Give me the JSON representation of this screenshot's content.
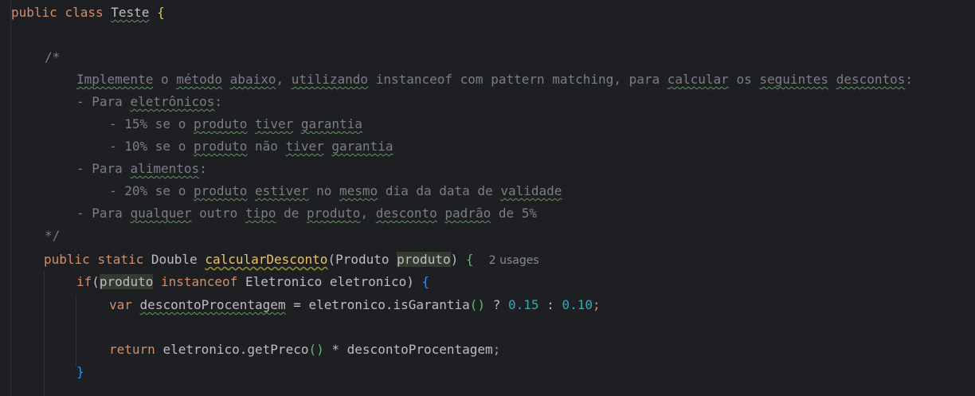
{
  "code": {
    "l1": {
      "public": "public",
      "class": "class",
      "classname": "Teste",
      "brace": "{"
    },
    "l3": {
      "open": "/*"
    },
    "l4": {
      "w1": "Implemente",
      "s1": " o ",
      "w2": "método",
      "s2": " ",
      "w3": "abaixo",
      "s3": ", ",
      "w4": "utilizando",
      "s4": " instanceof com pattern matching, para ",
      "w5": "calcular",
      "s5": " os ",
      "w6": "seguintes",
      "s6": " ",
      "w7": "descontos",
      "s7": ":"
    },
    "l5": {
      "pre": "- Para ",
      "w1": "eletrônicos",
      "post": ":"
    },
    "l6": {
      "pre": "- 15% se o ",
      "w1": "produto",
      "s1": " ",
      "w2": "tiver",
      "s2": " ",
      "w3": "garantia"
    },
    "l7": {
      "pre": "- 10% se o ",
      "w1": "produto",
      "s1": " não ",
      "w2": "tiver",
      "s2": " ",
      "w3": "garantia"
    },
    "l8": {
      "pre": "- Para ",
      "w1": "alimentos",
      "post": ":"
    },
    "l9": {
      "pre": "- 20% se o ",
      "w1": "produto",
      "s1": " ",
      "w2": "estiver",
      "s2": " no ",
      "w3": "mesmo",
      "s3": " dia da data de ",
      "w4": "validade"
    },
    "l10": {
      "pre": "- Para ",
      "w1": "qualquer",
      "s1": " outro ",
      "w2": "tipo",
      "s2": " de ",
      "w3": "produto",
      "s3": ", ",
      "w4": "desconto",
      "s4": " ",
      "w5": "padrão",
      "s5": " de 5%"
    },
    "l11": {
      "close": "*/"
    },
    "l12": {
      "public": "public",
      "static": "static",
      "type": "Double",
      "method": "calcularDesconto",
      "paren_open": "(",
      "ptype": "Produto",
      "pname": "produto",
      "paren_close": ")",
      "brace": "{",
      "usages": "2 usages"
    },
    "l13": {
      "if": "if",
      "paren_open": "(",
      "var": "produto",
      "instanceof": "instanceof",
      "cls": "Eletronico",
      "name": "eletronico",
      "paren_close": ")",
      "brace": "{"
    },
    "l14": {
      "var": "var",
      "name": "descontoProcentagem",
      "eq": "=",
      "call": "eletronico.isGarantia",
      "parens": "()",
      "q": "?",
      "n1": "0.15",
      "colon": ":",
      "n2": "0.10",
      "semi": ";"
    },
    "l16": {
      "return": "return",
      "call": "eletronico.getPreco",
      "parens": "()",
      "op": "*",
      "name": "descontoProcentagem",
      "semi": ";"
    },
    "l17": {
      "brace": "}"
    }
  },
  "colors": {
    "background": "#1e1f22",
    "keyword": "#cf8e6d",
    "method": "#56a8f5",
    "comment": "#7a7e85",
    "number": "#2aacb8",
    "text": "#bcbec4"
  }
}
